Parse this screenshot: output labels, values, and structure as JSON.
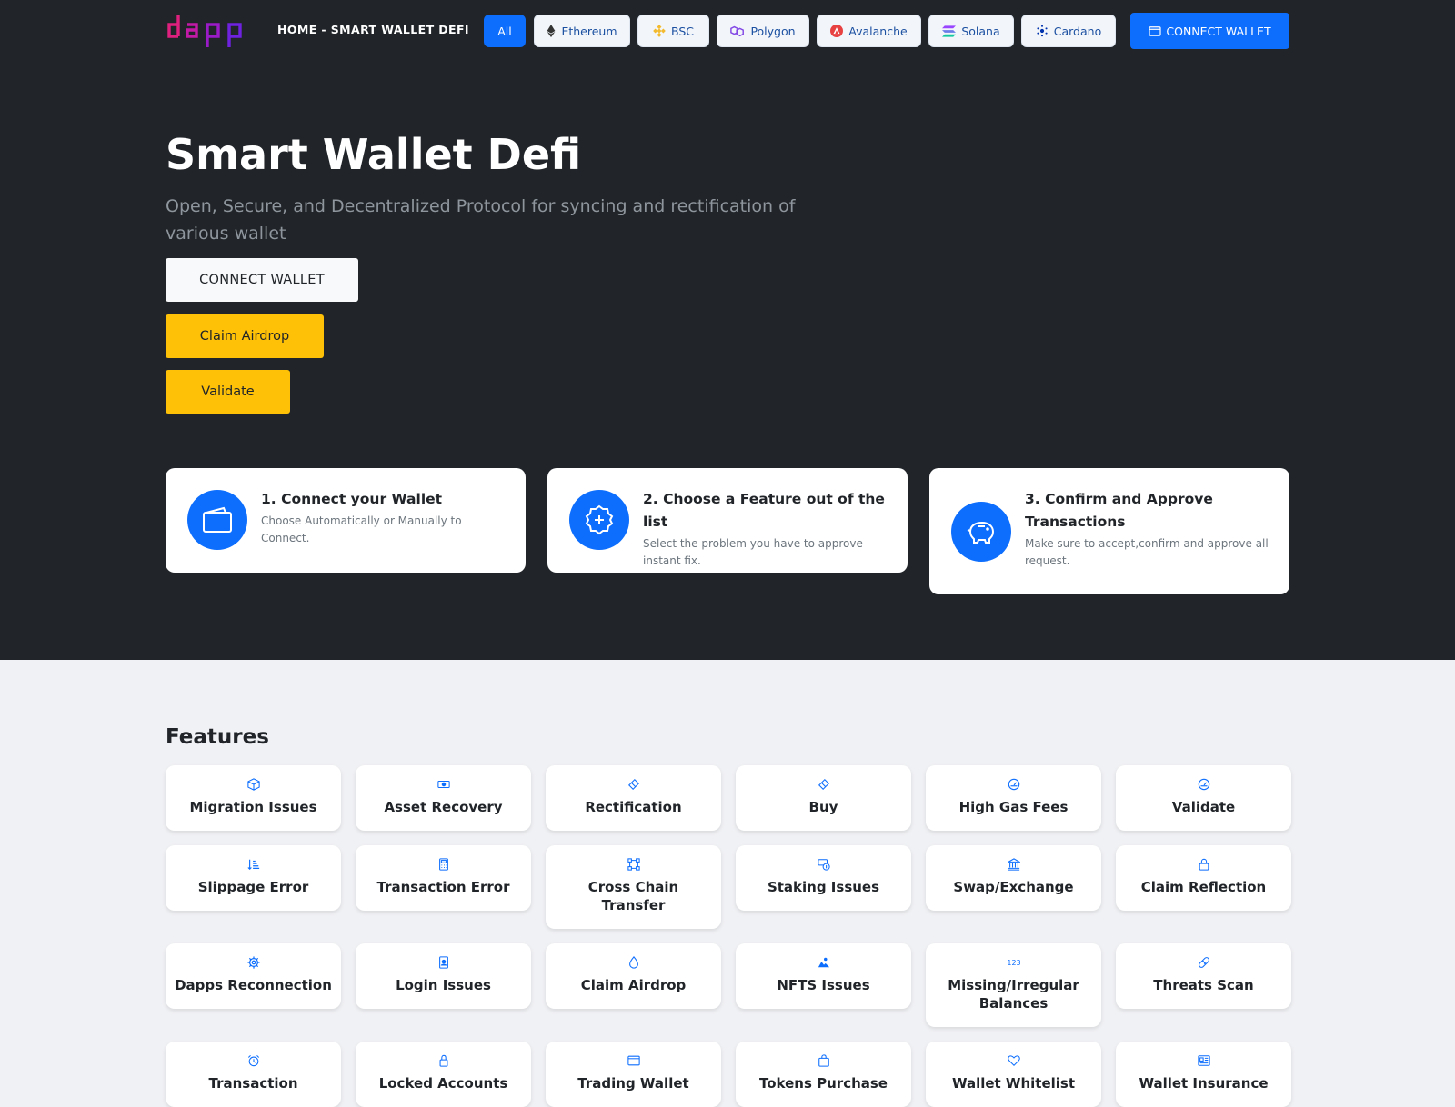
{
  "header": {
    "title": "HOME - SMART WALLET DEFI",
    "chains": [
      {
        "label": "All",
        "icon": "none",
        "active": true
      },
      {
        "label": "Ethereum",
        "icon": "ethereum-icon"
      },
      {
        "label": "BSC",
        "icon": "bsc-icon"
      },
      {
        "label": "Polygon",
        "icon": "polygon-icon"
      },
      {
        "label": "Avalanche",
        "icon": "avalanche-icon"
      },
      {
        "label": "Solana",
        "icon": "solana-icon"
      },
      {
        "label": "Cardano",
        "icon": "cardano-icon"
      }
    ],
    "connect_label": "CONNECT WALLET"
  },
  "hero": {
    "title": "Smart Wallet Defi",
    "subtitle": "Open, Secure, and Decentralized Protocol for syncing and rectification of various wallet",
    "buttons": {
      "connect": "CONNECT WALLET",
      "claim": "Claim Airdrop",
      "validate": "Validate"
    }
  },
  "steps": [
    {
      "title": "1. Connect your Wallet",
      "desc": "Choose Automatically or Manually to Connect.",
      "icon": "wallet-icon"
    },
    {
      "title": "2. Choose a Feature out of the list",
      "desc": "Select the problem you have to approve instant fix.",
      "icon": "plus-badge-icon"
    },
    {
      "title": "3. Confirm and Approve Transactions",
      "desc": "Make sure to accept,confirm and approve all request.",
      "icon": "piggy-bank-icon"
    }
  ],
  "features": {
    "heading": "Features",
    "items": [
      {
        "label": "Migration Issues",
        "icon": "box-icon"
      },
      {
        "label": "Asset Recovery",
        "icon": "cash-icon"
      },
      {
        "label": "Rectification",
        "icon": "eraser-icon"
      },
      {
        "label": "Buy",
        "icon": "tag-icon"
      },
      {
        "label": "High Gas Fees",
        "icon": "speedometer-icon"
      },
      {
        "label": "Validate",
        "icon": "speedometer-icon"
      },
      {
        "label": "Slippage Error",
        "icon": "sort-icon"
      },
      {
        "label": "Transaction Error",
        "icon": "calculator-icon"
      },
      {
        "label": "Cross Chain Transfer",
        "icon": "bezier-icon"
      },
      {
        "label": "Staking Issues",
        "icon": "coins-icon"
      },
      {
        "label": "Swap/Exchange",
        "icon": "bank-icon"
      },
      {
        "label": "Claim Reflection",
        "icon": "lock-icon"
      },
      {
        "label": "Dapps Reconnection",
        "icon": "gear-icon"
      },
      {
        "label": "Login Issues",
        "icon": "id-badge-icon"
      },
      {
        "label": "Claim Airdrop",
        "icon": "droplet-icon"
      },
      {
        "label": "NFTS Issues",
        "icon": "image-icon"
      },
      {
        "label": "Missing/Irregular Balances",
        "icon": "numbers-123-icon"
      },
      {
        "label": "Threats Scan",
        "icon": "bandaid-icon"
      },
      {
        "label": "Transaction",
        "icon": "alarm-icon"
      },
      {
        "label": "Locked Accounts",
        "icon": "lock-icon"
      },
      {
        "label": "Trading Wallet",
        "icon": "window-icon"
      },
      {
        "label": "Tokens Purchase",
        "icon": "bag-icon"
      },
      {
        "label": "Wallet Whitelist",
        "icon": "heart-icon"
      },
      {
        "label": "Wallet Insurance",
        "icon": "newspaper-icon"
      }
    ]
  },
  "colors": {
    "dark_bg": "#212529",
    "primary": "#0d6efd",
    "warning": "#ffc107",
    "light_bg": "#f0f1f4",
    "logo": "#d11fb4"
  }
}
